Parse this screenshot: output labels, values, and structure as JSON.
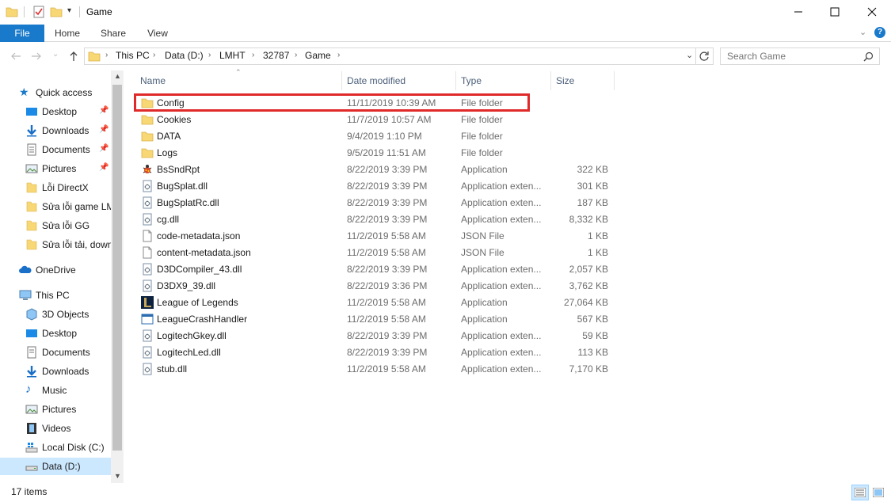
{
  "window": {
    "title": "Game",
    "controls": [
      "minimize-icon",
      "maximize-icon",
      "close-icon"
    ]
  },
  "ribbon": {
    "tabs": [
      "File",
      "Home",
      "Share",
      "View"
    ]
  },
  "address": {
    "crumbs": [
      "This PC",
      "Data (D:)",
      "LMHT",
      "32787",
      "Game"
    ]
  },
  "search": {
    "placeholder": "Search Game"
  },
  "nav": {
    "quick_access": "Quick access",
    "quick_items": [
      "Desktop",
      "Downloads",
      "Documents",
      "Pictures",
      "Lỗi DirectX",
      "Sửa lỗi game LMHT",
      "Sửa lỗi GG",
      "Sửa lỗi tải, download"
    ],
    "onedrive": "OneDrive",
    "this_pc": "This PC",
    "pc_items": [
      "3D Objects",
      "Desktop",
      "Documents",
      "Downloads",
      "Music",
      "Pictures",
      "Videos",
      "Local Disk (C:)",
      "Data (D:)"
    ]
  },
  "columns": {
    "name": "Name",
    "date": "Date modified",
    "type": "Type",
    "size": "Size"
  },
  "files": [
    {
      "name": "Config",
      "date": "11/11/2019 10:39 AM",
      "type": "File folder",
      "size": "",
      "icon": "folder-icon"
    },
    {
      "name": "Cookies",
      "date": "11/7/2019 10:57 AM",
      "type": "File folder",
      "size": "",
      "icon": "folder-icon"
    },
    {
      "name": "DATA",
      "date": "9/4/2019 1:10 PM",
      "type": "File folder",
      "size": "",
      "icon": "folder-icon"
    },
    {
      "name": "Logs",
      "date": "9/5/2019 11:51 AM",
      "type": "File folder",
      "size": "",
      "icon": "folder-icon"
    },
    {
      "name": "BsSndRpt",
      "date": "8/22/2019 3:39 PM",
      "type": "Application",
      "size": "322 KB",
      "icon": "bugsplat-app-icon"
    },
    {
      "name": "BugSplat.dll",
      "date": "8/22/2019 3:39 PM",
      "type": "Application exten...",
      "size": "301 KB",
      "icon": "dll-icon"
    },
    {
      "name": "BugSplatRc.dll",
      "date": "8/22/2019 3:39 PM",
      "type": "Application exten...",
      "size": "187 KB",
      "icon": "dll-icon"
    },
    {
      "name": "cg.dll",
      "date": "8/22/2019 3:39 PM",
      "type": "Application exten...",
      "size": "8,332 KB",
      "icon": "dll-icon"
    },
    {
      "name": "code-metadata.json",
      "date": "11/2/2019 5:58 AM",
      "type": "JSON File",
      "size": "1 KB",
      "icon": "file-icon"
    },
    {
      "name": "content-metadata.json",
      "date": "11/2/2019 5:58 AM",
      "type": "JSON File",
      "size": "1 KB",
      "icon": "file-icon"
    },
    {
      "name": "D3DCompiler_43.dll",
      "date": "8/22/2019 3:39 PM",
      "type": "Application exten...",
      "size": "2,057 KB",
      "icon": "dll-icon"
    },
    {
      "name": "D3DX9_39.dll",
      "date": "8/22/2019 3:36 PM",
      "type": "Application exten...",
      "size": "3,762 KB",
      "icon": "dll-icon"
    },
    {
      "name": "League of Legends",
      "date": "11/2/2019 5:58 AM",
      "type": "Application",
      "size": "27,064 KB",
      "icon": "league-app-icon"
    },
    {
      "name": "LeagueCrashHandler",
      "date": "11/2/2019 5:58 AM",
      "type": "Application",
      "size": "567 KB",
      "icon": "app-window-icon"
    },
    {
      "name": "LogitechGkey.dll",
      "date": "8/22/2019 3:39 PM",
      "type": "Application exten...",
      "size": "59 KB",
      "icon": "dll-icon"
    },
    {
      "name": "LogitechLed.dll",
      "date": "8/22/2019 3:39 PM",
      "type": "Application exten...",
      "size": "113 KB",
      "icon": "dll-icon"
    },
    {
      "name": "stub.dll",
      "date": "11/2/2019 5:58 AM",
      "type": "Application exten...",
      "size": "7,170 KB",
      "icon": "dll-icon"
    }
  ],
  "status": {
    "count": "17 items"
  },
  "colors": {
    "accent": "#1979ca",
    "folder": "#f8d775",
    "highlight": "#e02a2a",
    "selected": "#cce8ff"
  }
}
